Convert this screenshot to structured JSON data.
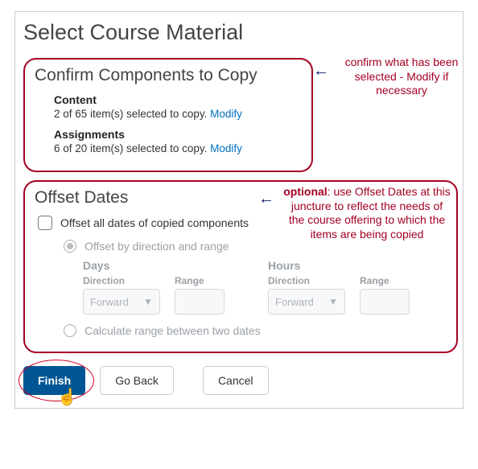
{
  "page": {
    "title": "Select Course Material"
  },
  "confirm": {
    "heading": "Confirm Components to Copy",
    "annotation": "confirm what has been selected - Modify if necessary",
    "components": [
      {
        "label": "Content",
        "desc": "2 of 65 item(s) selected to copy.",
        "modify": "Modify"
      },
      {
        "label": "Assignments",
        "desc": "6 of 20 item(s) selected to copy.",
        "modify": "Modify"
      }
    ]
  },
  "offset": {
    "heading": "Offset Dates",
    "annotation_bold": "optional",
    "annotation_rest": ": use Offset Dates at this juncture to reflect the needs of the course offering to which the items are being copied",
    "checkbox_label": "Offset all dates of copied components",
    "radio1": "Offset by direction and range",
    "radio2": "Calculate range between two dates",
    "groups": {
      "days": {
        "title": "Days",
        "direction_label": "Direction",
        "range_label": "Range",
        "direction_value": "Forward"
      },
      "hours": {
        "title": "Hours",
        "direction_label": "Direction",
        "range_label": "Range",
        "direction_value": "Forward"
      }
    }
  },
  "buttons": {
    "finish": "Finish",
    "go_back": "Go Back",
    "cancel": "Cancel"
  }
}
